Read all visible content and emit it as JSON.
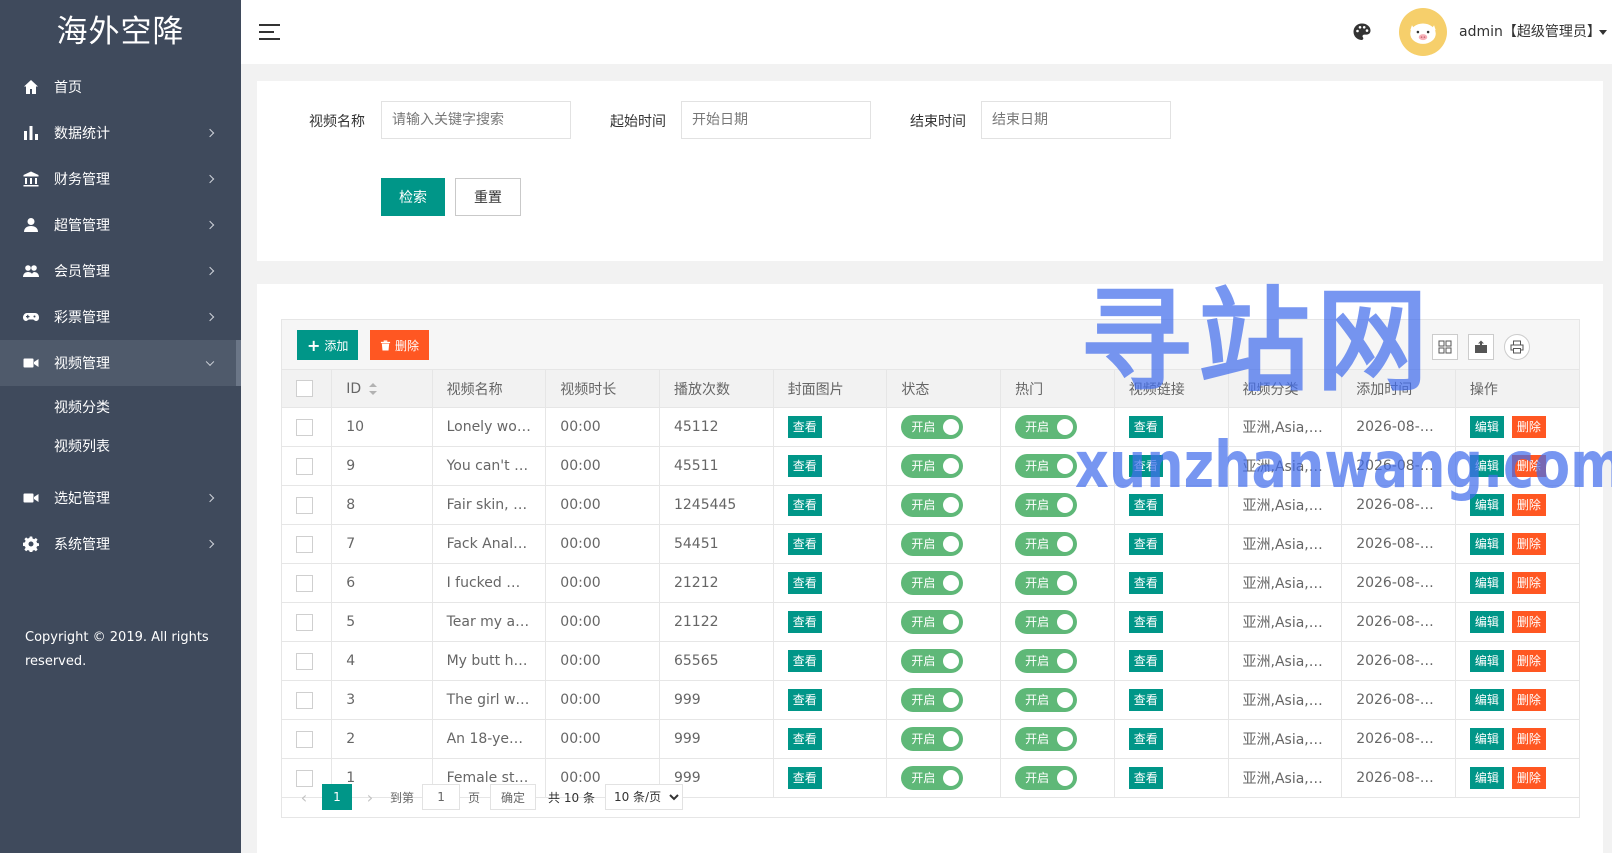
{
  "app": {
    "logo": "海外空降"
  },
  "sidebar": {
    "items": [
      {
        "label": "首页",
        "icon": "home-icon"
      },
      {
        "label": "数据统计",
        "icon": "bar-chart-icon"
      },
      {
        "label": "财务管理",
        "icon": "bank-icon"
      },
      {
        "label": "超管管理",
        "icon": "user-icon"
      },
      {
        "label": "会员管理",
        "icon": "users-icon"
      },
      {
        "label": "彩票管理",
        "icon": "gamepad-icon"
      },
      {
        "label": "视频管理",
        "icon": "video-icon"
      },
      {
        "label": "选妃管理",
        "icon": "video-icon"
      },
      {
        "label": "系统管理",
        "icon": "gear-icon"
      }
    ],
    "submenu": [
      "视频分类",
      "视频列表"
    ],
    "copyright": "Copyright © 2019. All rights reserved."
  },
  "header": {
    "user": "admin【超级管理员】"
  },
  "search": {
    "name_label": "视频名称",
    "name_placeholder": "请输入关键字搜索",
    "start_label": "起始时间",
    "start_placeholder": "开始日期",
    "end_label": "结束时间",
    "end_placeholder": "结束日期",
    "search_btn": "检索",
    "reset_btn": "重置"
  },
  "toolbar": {
    "add": "添加",
    "delete": "删除"
  },
  "table": {
    "headers": [
      "ID",
      "视频名称",
      "视频时长",
      "播放次数",
      "封面图片",
      "状态",
      "热门",
      "视频链接",
      "视频分类",
      "添加时间",
      "操作"
    ],
    "view_label": "查看",
    "switch_label": "开启",
    "edit_label": "编辑",
    "remove_label": "删除",
    "rows": [
      {
        "id": "10",
        "name": "Lonely wo…",
        "duration": "00:00",
        "plays": "45112",
        "category": "亚洲,Asia,…",
        "added": "2026-08-0…"
      },
      {
        "id": "9",
        "name": "You can't c…",
        "duration": "00:00",
        "plays": "45511",
        "category": "亚洲,Asia,…",
        "added": "2026-08-0…"
      },
      {
        "id": "8",
        "name": "Fair skin, b…",
        "duration": "00:00",
        "plays": "1245445",
        "category": "亚洲,Asia,…",
        "added": "2026-08-0…"
      },
      {
        "id": "7",
        "name": "Fack Anal …",
        "duration": "00:00",
        "plays": "54451",
        "category": "亚洲,Asia,…",
        "added": "2026-08-0…"
      },
      {
        "id": "6",
        "name": "I fucked m…",
        "duration": "00:00",
        "plays": "21212",
        "category": "亚洲,Asia,…",
        "added": "2026-08-0…"
      },
      {
        "id": "5",
        "name": "Tear my as…",
        "duration": "00:00",
        "plays": "21122",
        "category": "亚洲,Asia,…",
        "added": "2026-08-0…"
      },
      {
        "id": "4",
        "name": "My butt hu…",
        "duration": "00:00",
        "plays": "65565",
        "category": "亚洲,Asia,…",
        "added": "2026-08-0…"
      },
      {
        "id": "3",
        "name": "The girl wa…",
        "duration": "00:00",
        "plays": "999",
        "category": "亚洲,Asia,…",
        "added": "2026-08-0…"
      },
      {
        "id": "2",
        "name": "An 18-year…",
        "duration": "00:00",
        "plays": "999",
        "category": "亚洲,Asia,…",
        "added": "2026-08-0…"
      },
      {
        "id": "1",
        "name": "Female st…",
        "duration": "00:00",
        "plays": "999",
        "category": "亚洲,Asia,…",
        "added": "2026-08-0…"
      }
    ]
  },
  "pager": {
    "current": "1",
    "goto_label": "到第",
    "page_value": "1",
    "page_unit": "页",
    "confirm": "确定",
    "total": "共 10 条",
    "page_size": "10 条/页"
  },
  "watermark": {
    "big": "寻站网",
    "small": "xunzhanwang.com"
  }
}
